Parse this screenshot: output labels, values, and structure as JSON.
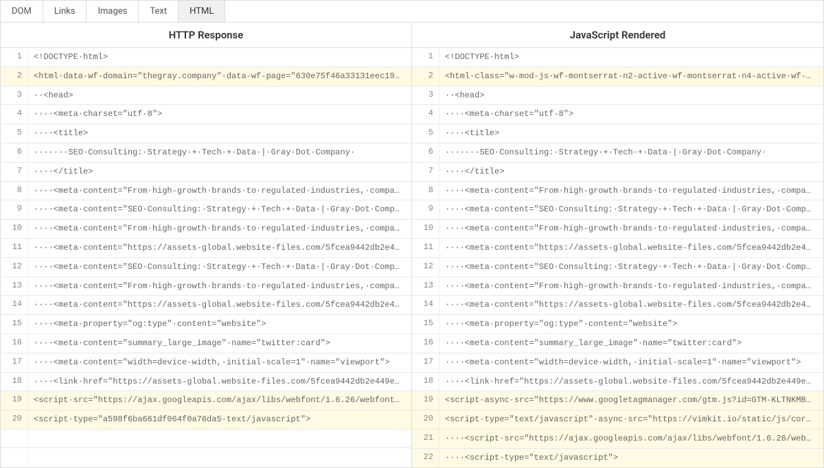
{
  "tabs": [
    {
      "id": "dom",
      "label": "DOM",
      "active": false
    },
    {
      "id": "links",
      "label": "Links",
      "active": false
    },
    {
      "id": "images",
      "label": "Images",
      "active": false
    },
    {
      "id": "text",
      "label": "Text",
      "active": false
    },
    {
      "id": "html",
      "label": "HTML",
      "active": true
    }
  ],
  "panels": {
    "left": {
      "title": "HTTP Response",
      "lines": [
        {
          "n": 1,
          "text": "<!DOCTYPE·html>",
          "hl": false
        },
        {
          "n": 2,
          "text": "<html·data-wf-domain=\"thegray.company\"·data-wf-page=\"630e75f46a33131eec19…",
          "hl": true
        },
        {
          "n": 3,
          "text": "··<head>",
          "hl": false
        },
        {
          "n": 4,
          "text": "····<meta·charset=\"utf-8\">",
          "hl": false
        },
        {
          "n": 5,
          "text": "····<title>",
          "hl": false
        },
        {
          "n": 6,
          "text": "·······SEO·Consulting:·Strategy·+·Tech·+·Data·|·Gray·Dot·Company·",
          "hl": false
        },
        {
          "n": 7,
          "text": "····</title>",
          "hl": false
        },
        {
          "n": 8,
          "text": "····<meta·content=\"From·high-growth·brands·to·regulated·industries,·compa…",
          "hl": false
        },
        {
          "n": 9,
          "text": "····<meta·content=\"SEO·Consulting:·Strategy·+·Tech·+·Data·|·Gray·Dot·Comp…",
          "hl": false
        },
        {
          "n": 10,
          "text": "····<meta·content=\"From·high-growth·brands·to·regulated·industries,·compa…",
          "hl": false
        },
        {
          "n": 11,
          "text": "····<meta·content=\"https://assets-global.website-files.com/5fcea9442db2e4…",
          "hl": false
        },
        {
          "n": 12,
          "text": "····<meta·content=\"SEO·Consulting:·Strategy·+·Tech·+·Data·|·Gray·Dot·Comp…",
          "hl": false
        },
        {
          "n": 13,
          "text": "····<meta·content=\"From·high-growth·brands·to·regulated·industries,·compa…",
          "hl": false
        },
        {
          "n": 14,
          "text": "····<meta·content=\"https://assets-global.website-files.com/5fcea9442db2e4…",
          "hl": false
        },
        {
          "n": 15,
          "text": "····<meta·property=\"og:type\"·content=\"website\">",
          "hl": false
        },
        {
          "n": 16,
          "text": "····<meta·content=\"summary_large_image\"·name=\"twitter:card\">",
          "hl": false
        },
        {
          "n": 17,
          "text": "····<meta·content=\"width=device-width,·initial-scale=1\"·name=\"viewport\">",
          "hl": false
        },
        {
          "n": 18,
          "text": "····<link·href=\"https://assets-global.website-files.com/5fcea9442db2e449e…",
          "hl": false
        },
        {
          "n": 19,
          "text": "<script·src=\"https://ajax.googleapis.com/ajax/libs/webfont/1.6.26/webfont…",
          "hl": true
        },
        {
          "n": 20,
          "text": "<script·type=\"a598f6ba661df064f0a76da5-text/javascript\">",
          "hl": true
        },
        {
          "n": "",
          "text": "",
          "hl": false
        },
        {
          "n": "",
          "text": "",
          "hl": false
        }
      ]
    },
    "right": {
      "title": "JavaScript Rendered",
      "lines": [
        {
          "n": 1,
          "text": "<!DOCTYPE·html>",
          "hl": false
        },
        {
          "n": 2,
          "text": "<html·class=\"w-mod-js·wf-montserrat-n2-active·wf-montserrat-n4-active·wf-…",
          "hl": true
        },
        {
          "n": 3,
          "text": "··<head>",
          "hl": false
        },
        {
          "n": 4,
          "text": "····<meta·charset=\"utf-8\">",
          "hl": false
        },
        {
          "n": 5,
          "text": "····<title>",
          "hl": false
        },
        {
          "n": 6,
          "text": "·······SEO·Consulting:·Strategy·+·Tech·+·Data·|·Gray·Dot·Company·",
          "hl": false
        },
        {
          "n": 7,
          "text": "····</title>",
          "hl": false
        },
        {
          "n": 8,
          "text": "····<meta·content=\"From·high-growth·brands·to·regulated·industries,·compa…",
          "hl": false
        },
        {
          "n": 9,
          "text": "····<meta·content=\"SEO·Consulting:·Strategy·+·Tech·+·Data·|·Gray·Dot·Comp…",
          "hl": false
        },
        {
          "n": 10,
          "text": "····<meta·content=\"From·high-growth·brands·to·regulated·industries,·compa…",
          "hl": false
        },
        {
          "n": 11,
          "text": "····<meta·content=\"https://assets-global.website-files.com/5fcea9442db2e4…",
          "hl": false
        },
        {
          "n": 12,
          "text": "····<meta·content=\"SEO·Consulting:·Strategy·+·Tech·+·Data·|·Gray·Dot·Comp…",
          "hl": false
        },
        {
          "n": 13,
          "text": "····<meta·content=\"From·high-growth·brands·to·regulated·industries,·compa…",
          "hl": false
        },
        {
          "n": 14,
          "text": "····<meta·content=\"https://assets-global.website-files.com/5fcea9442db2e4…",
          "hl": false
        },
        {
          "n": 15,
          "text": "····<meta·property=\"og:type\"·content=\"website\">",
          "hl": false
        },
        {
          "n": 16,
          "text": "····<meta·content=\"summary_large_image\"·name=\"twitter:card\">",
          "hl": false
        },
        {
          "n": 17,
          "text": "····<meta·content=\"width=device-width,·initial-scale=1\"·name=\"viewport\">",
          "hl": false
        },
        {
          "n": 18,
          "text": "····<link·href=\"https://assets-global.website-files.com/5fcea9442db2e449e…",
          "hl": false
        },
        {
          "n": 19,
          "text": "<script·async·src=\"https://www.googletagmanager.com/gtm.js?id=GTM-KLTNKMB…",
          "hl": true
        },
        {
          "n": 20,
          "text": "<script·type=\"text/javascript\"·async·src=\"https://vimkit.io/static/js/cor…",
          "hl": true
        },
        {
          "n": 21,
          "text": "····<script·src=\"https://ajax.googleapis.com/ajax/libs/webfont/1.6.26/web…",
          "hl": true
        },
        {
          "n": 22,
          "text": "····<script·type=\"text/javascript\">",
          "hl": true
        }
      ]
    }
  }
}
